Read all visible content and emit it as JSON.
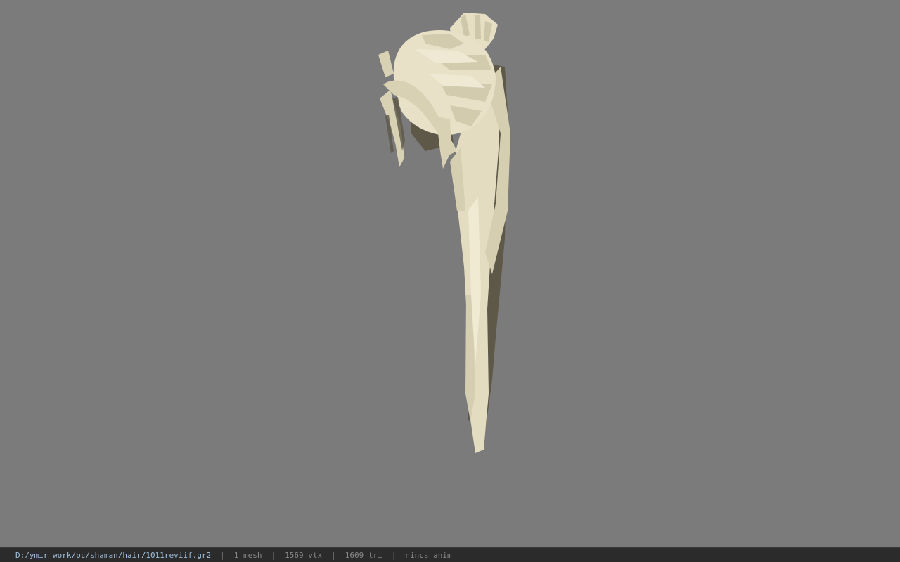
{
  "viewport": {
    "background_color": "#7b7b7b",
    "model_color": "#e3dcc0",
    "model_shade_color": "#5e5849"
  },
  "status": {
    "file_path": "D:/ymir work/pc/shaman/hair/1011reviif.gr2",
    "separator": "|",
    "mesh_count": "1 mesh",
    "vertex_count": "1569 vtx",
    "triangle_count": "1609 tri",
    "anim_status": "nincs anim"
  }
}
